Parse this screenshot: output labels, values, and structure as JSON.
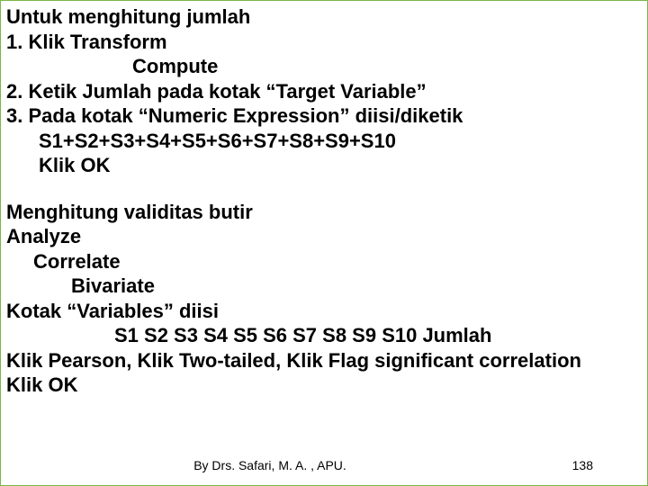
{
  "block1": {
    "l1": "Untuk menghitung jumlah",
    "l2": "1. Klik Transform",
    "l3": "Compute",
    "l4": "2. Ketik Jumlah pada kotak “Target Variable”",
    "l5": "3. Pada kotak “Numeric Expression” diisi/diketik",
    "l6": "S1+S2+S3+S4+S5+S6+S7+S8+S9+S10",
    "l7": "Klik OK"
  },
  "block2": {
    "l1": "Menghitung validitas butir",
    "l2": "Analyze",
    "l3": "Correlate",
    "l4": "Bivariate",
    "l5": "Kotak “Variables” diisi",
    "l6": "S1 S2 S3 S4 S5 S6 S7 S8 S9 S10 Jumlah",
    "l7": "Klik Pearson, Klik Two-tailed, Klik Flag significant correlation",
    "l8": "Klik OK"
  },
  "footer": {
    "author": "By Drs. Safari, M. A. , APU.",
    "page": "138"
  }
}
